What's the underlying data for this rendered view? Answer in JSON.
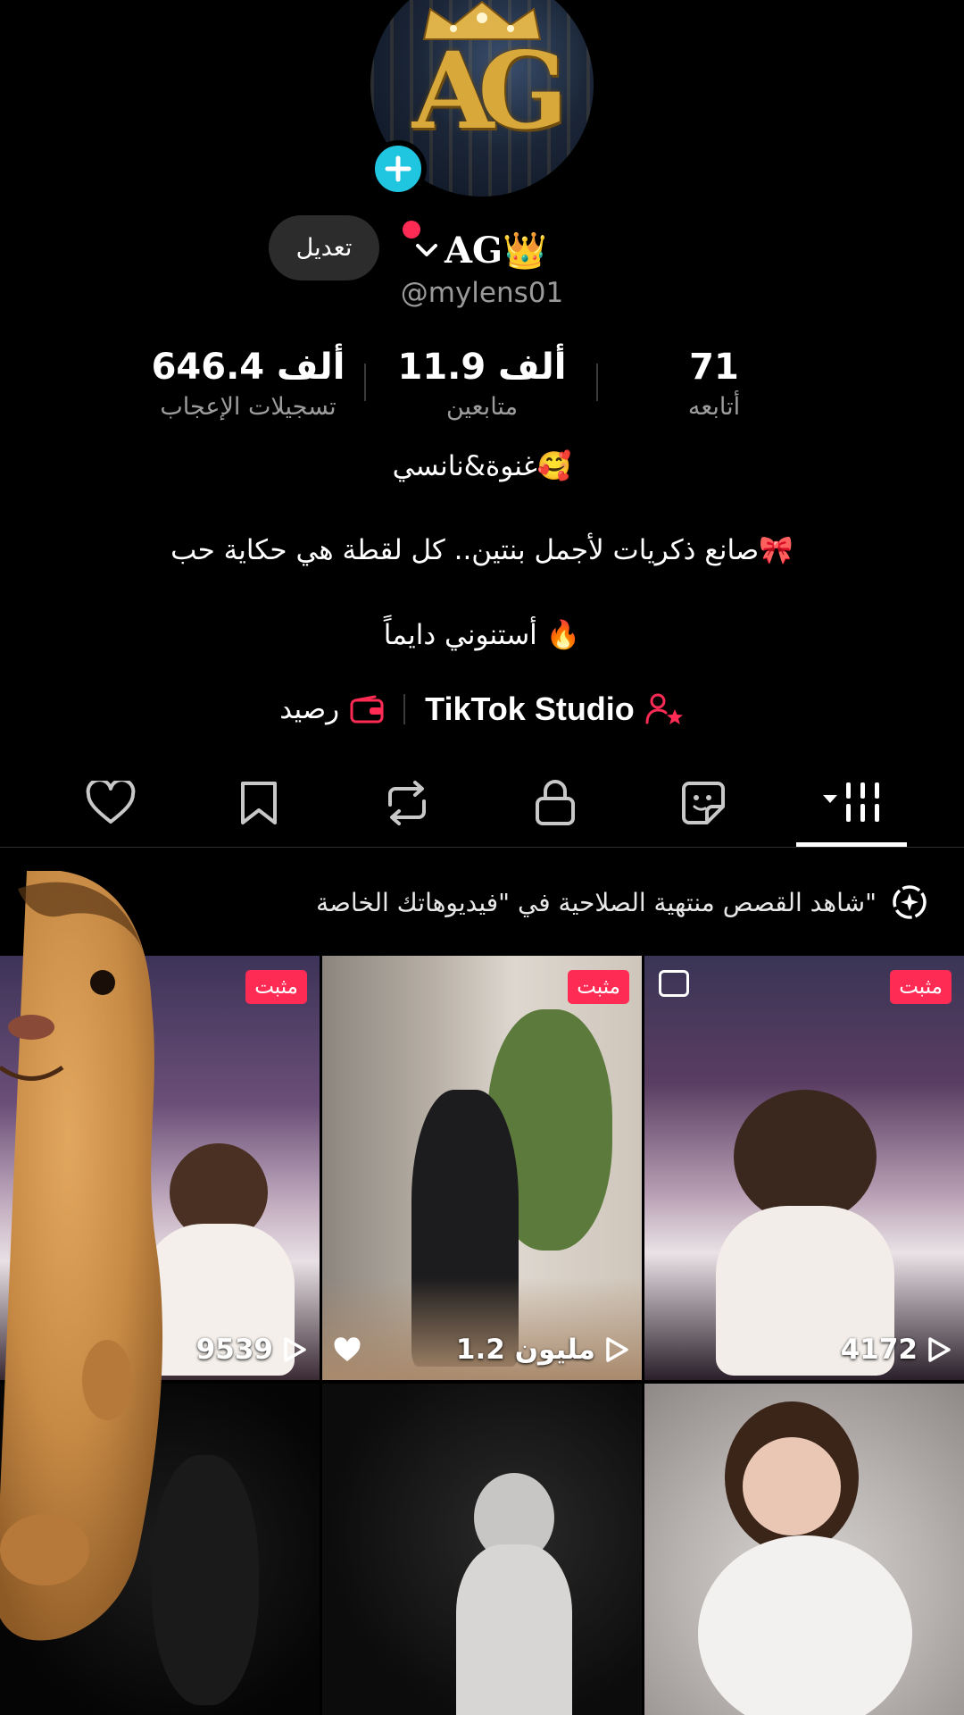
{
  "profile": {
    "display_name": "AG👑",
    "username": "@mylens01",
    "edit_label": "تعديل"
  },
  "stats": [
    {
      "value": "71",
      "label": "أتابعه"
    },
    {
      "value": "11.9 ألف",
      "label": "متابعين"
    },
    {
      "value": "646.4 ألف",
      "label": "تسجيلات الإعجاب"
    }
  ],
  "bio": {
    "line1": "غنوة&نانسي🥰",
    "line2": "صانع ذكريات لأجمل بنتين.. كل لقطة هي حكاية حب🎀",
    "line3": "أستنوني دايماً 🔥"
  },
  "links": {
    "studio_label": "TikTok Studio",
    "balance_label": "رصيد"
  },
  "tabs": [
    "videos",
    "stickers",
    "private",
    "reposts",
    "favorites",
    "liked"
  ],
  "notice": {
    "text": "شاهد القصص منتهية الصلاحية في \"فيديوهاتك الخاصة\""
  },
  "grid": [
    {
      "pinned_label": "مثبت",
      "views": "4172",
      "multi_image": true
    },
    {
      "pinned_label": "مثبت",
      "views": "1.2 مليون",
      "liked": true
    },
    {
      "pinned_label": "مثبت",
      "views": "9539"
    }
  ],
  "colors": {
    "accent": "#fe2c55",
    "add_button": "#20c5e0",
    "muted_text": "#9c9c9c"
  }
}
